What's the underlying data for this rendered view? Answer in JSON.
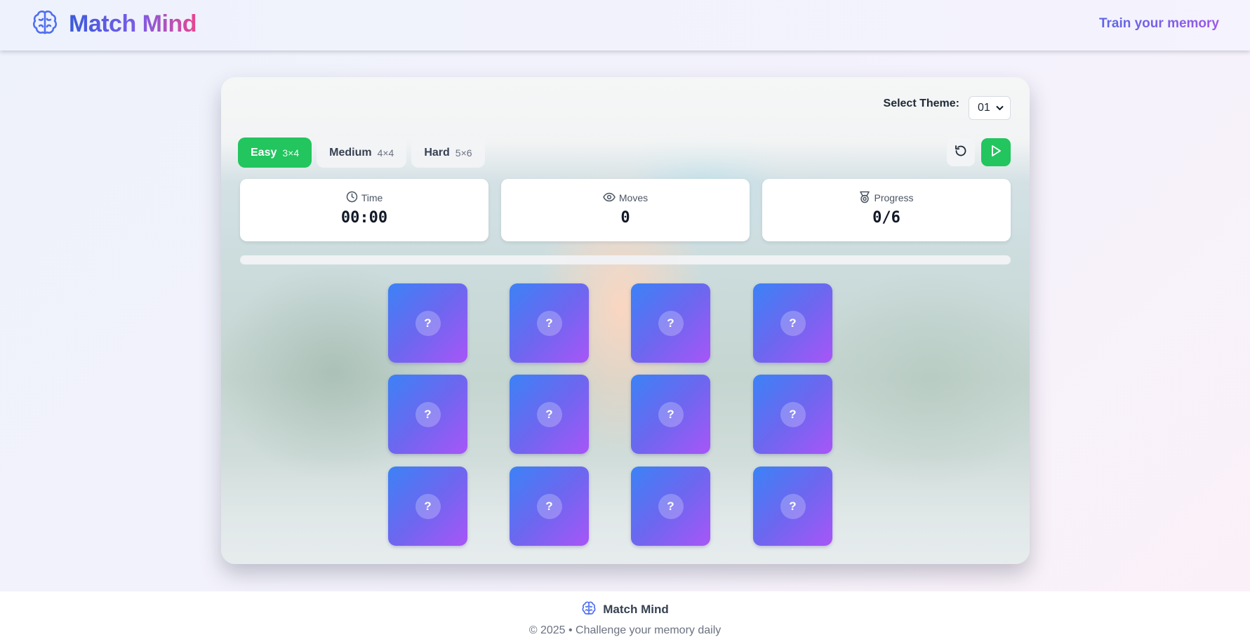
{
  "header": {
    "logo_icon": "brain-icon",
    "title": "Match Mind",
    "tagline": "Train your memory"
  },
  "theme": {
    "label": "Select Theme:",
    "selected": "01",
    "background_image": "blurred-forest-river-icon"
  },
  "difficulty": [
    {
      "label": "Easy",
      "size": "3×4",
      "active": true
    },
    {
      "label": "Medium",
      "size": "4×4",
      "active": false
    },
    {
      "label": "Hard",
      "size": "5×6",
      "active": false
    }
  ],
  "actions": {
    "reset_icon": "reset-icon",
    "play_icon": "play-icon"
  },
  "stats": {
    "time": {
      "label": "Time",
      "value": "00:00",
      "icon": "clock-icon"
    },
    "moves": {
      "label": "Moves",
      "value": "0",
      "icon": "eye-icon"
    },
    "progress": {
      "label": "Progress",
      "value": "0/6",
      "icon": "medal-icon"
    }
  },
  "progress_fraction": 0,
  "board": {
    "cards": [
      {
        "face": "?"
      },
      {
        "face": "?"
      },
      {
        "face": "?"
      },
      {
        "face": "?"
      },
      {
        "face": "?"
      },
      {
        "face": "?"
      },
      {
        "face": "?"
      },
      {
        "face": "?"
      },
      {
        "face": "?"
      },
      {
        "face": "?"
      },
      {
        "face": "?"
      },
      {
        "face": "?"
      }
    ]
  },
  "footer": {
    "brand": "Match Mind",
    "copyright": "© 2025 • Challenge your memory daily"
  },
  "colors": {
    "accent_green": "#22c55e",
    "card_gradient_start": "#3b82f6",
    "card_gradient_end": "#a855f7",
    "brand_blue": "#3b5bdb",
    "brand_pink": "#e9468f"
  }
}
